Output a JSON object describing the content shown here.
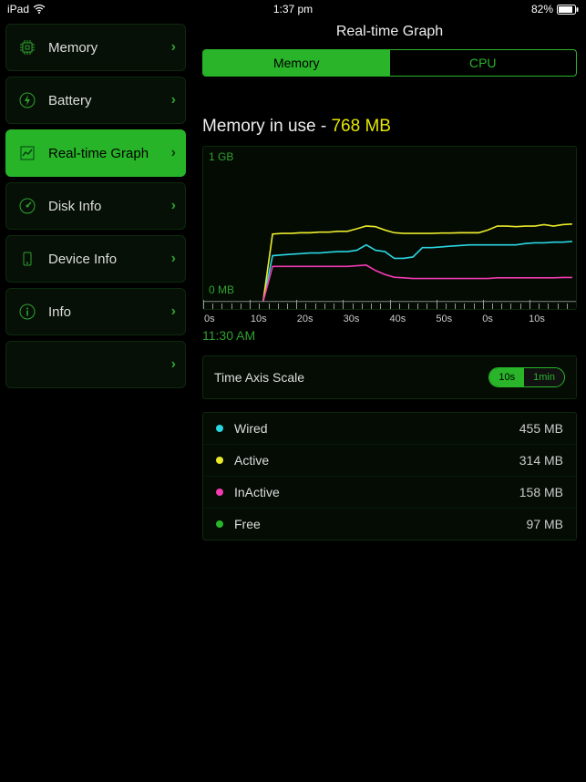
{
  "status": {
    "device": "iPad",
    "time": "1:37 pm",
    "battery_pct": "82%"
  },
  "sidebar": {
    "items": [
      {
        "label": "Memory"
      },
      {
        "label": "Battery"
      },
      {
        "label": "Real-time Graph"
      },
      {
        "label": "Disk Info"
      },
      {
        "label": "Device Info"
      },
      {
        "label": "Info"
      },
      {
        "label": ""
      }
    ],
    "active_index": 2
  },
  "header": {
    "title": "Real-time Graph"
  },
  "segmented": {
    "left": "Memory",
    "right": "CPU",
    "active": "left"
  },
  "memory": {
    "label_prefix": "Memory in use - ",
    "value": "768 MB"
  },
  "chart_data": {
    "type": "line",
    "y_top_label": "1 GB",
    "y_bottom_label": "0 MB",
    "ylim": [
      0,
      1024
    ],
    "x_ticks": [
      "0s",
      "10s",
      "20s",
      "30s",
      "40s",
      "50s",
      "0s",
      "10s"
    ],
    "time_label": "11:30 AM",
    "series": [
      {
        "name": "Wired",
        "color": "#2bd6e3",
        "values": [
          null,
          null,
          null,
          null,
          null,
          null,
          0,
          340,
          345,
          350,
          355,
          360,
          360,
          365,
          370,
          370,
          380,
          420,
          380,
          370,
          320,
          320,
          330,
          400,
          400,
          405,
          410,
          415,
          420,
          420,
          420,
          420,
          420,
          420,
          430,
          435,
          435,
          440,
          440,
          445
        ]
      },
      {
        "name": "Active",
        "color": "#e9e92c",
        "values": [
          null,
          null,
          null,
          null,
          null,
          null,
          0,
          500,
          505,
          505,
          510,
          510,
          515,
          515,
          520,
          520,
          540,
          560,
          555,
          530,
          510,
          505,
          505,
          505,
          505,
          508,
          508,
          510,
          510,
          510,
          530,
          560,
          560,
          555,
          560,
          560,
          570,
          560,
          570,
          575
        ]
      },
      {
        "name": "InActive",
        "color": "#f23bb0",
        "values": [
          null,
          null,
          null,
          null,
          null,
          null,
          0,
          260,
          260,
          260,
          260,
          260,
          260,
          260,
          260,
          260,
          265,
          270,
          230,
          200,
          180,
          175,
          170,
          170,
          170,
          170,
          170,
          170,
          170,
          170,
          170,
          175,
          175,
          175,
          175,
          175,
          175,
          175,
          178,
          178
        ]
      },
      {
        "name": "Free",
        "color": "#29b429",
        "values": [
          null,
          null,
          null,
          null,
          null,
          null,
          null,
          null,
          null,
          null,
          null,
          null,
          null,
          null,
          null,
          null,
          null,
          null,
          null,
          null,
          null,
          null,
          null,
          null,
          null,
          null,
          null,
          null,
          null,
          null,
          null,
          null,
          null,
          null,
          null,
          null,
          null,
          null,
          null,
          null
        ]
      }
    ]
  },
  "timescale": {
    "label": "Time Axis Scale",
    "opt1": "10s",
    "opt2": "1min",
    "active": "opt1"
  },
  "legend": [
    {
      "color": "#2bd6e3",
      "name": "Wired",
      "value": "455 MB"
    },
    {
      "color": "#e9e92c",
      "name": "Active",
      "value": "314 MB"
    },
    {
      "color": "#f23bb0",
      "name": "InActive",
      "value": "158 MB"
    },
    {
      "color": "#29b429",
      "name": "Free",
      "value": "97 MB"
    }
  ]
}
